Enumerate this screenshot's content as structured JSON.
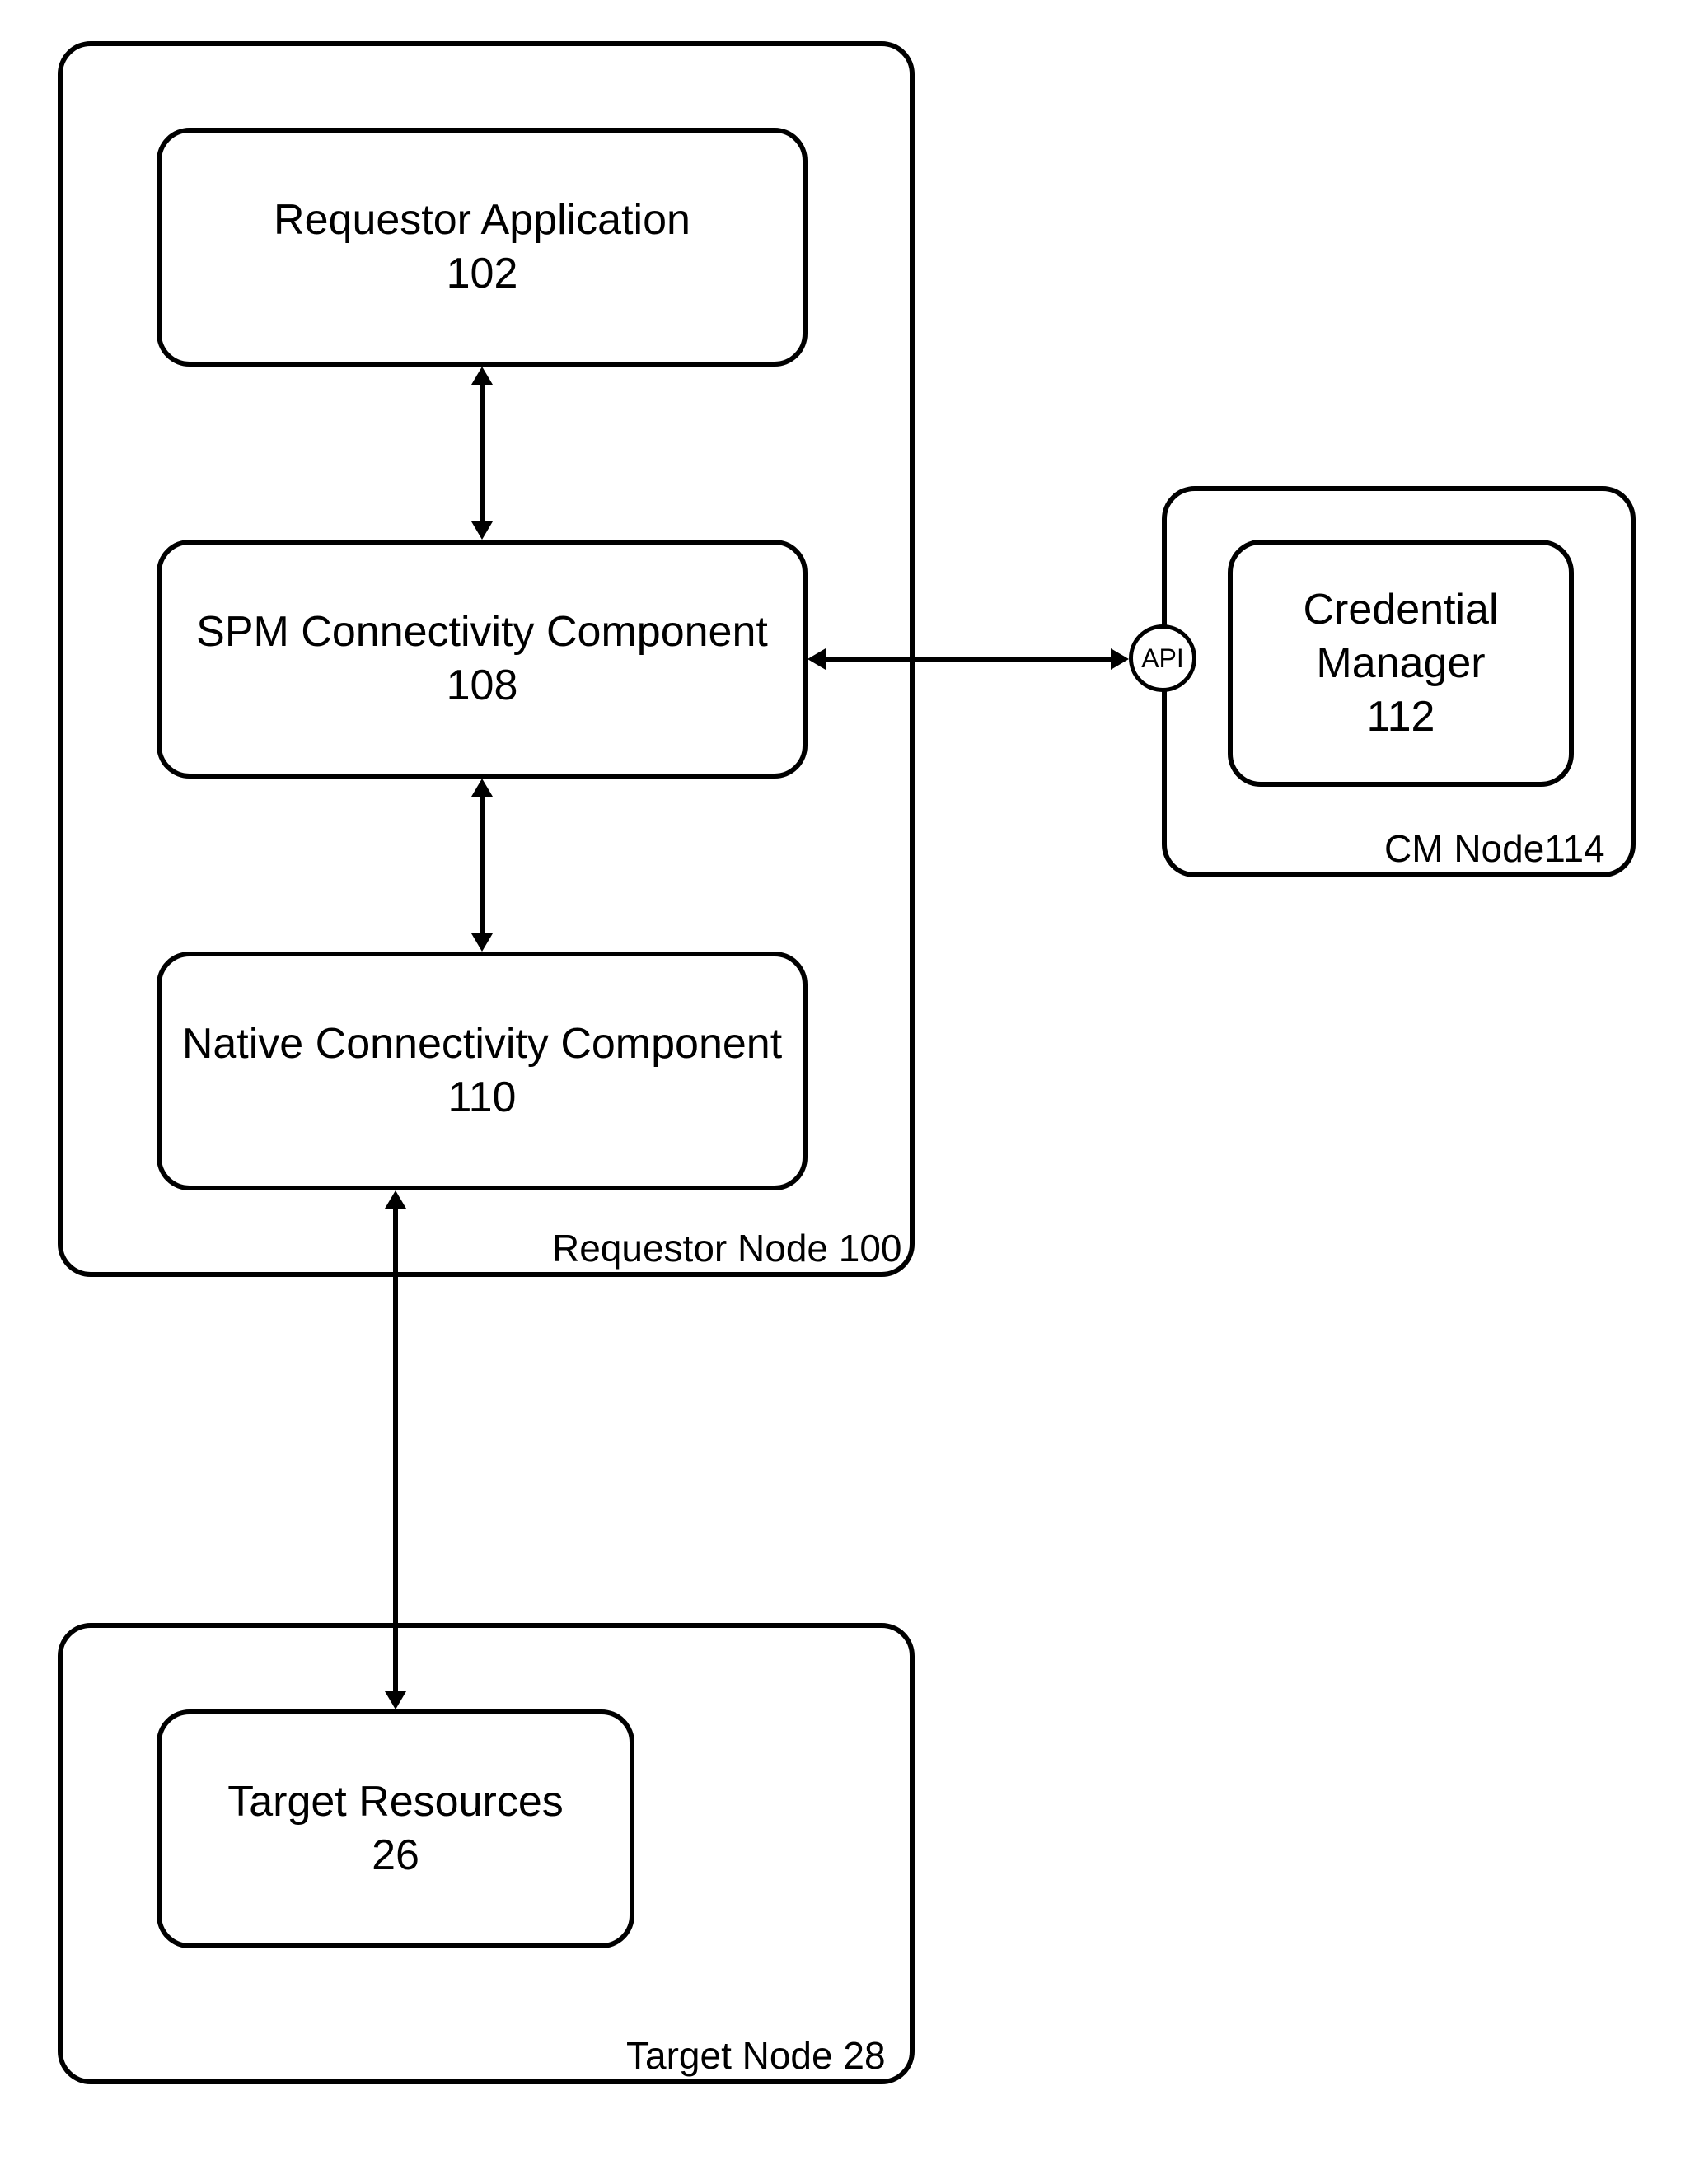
{
  "requestorNode": {
    "label": "Requestor Node 100",
    "requestorApp": {
      "title": "Requestor Application",
      "num": "102"
    },
    "spm": {
      "title": "SPM Connectivity Component",
      "num": "108"
    },
    "native": {
      "title": "Native Connectivity Component",
      "num": "110"
    }
  },
  "cmNode": {
    "label": "CM Node114",
    "credMgr": {
      "title1": "Credential",
      "title2": "Manager",
      "num": "112"
    }
  },
  "targetNode": {
    "label": "Target Node 28",
    "targetRes": {
      "title": "Target Resources",
      "num": "26"
    }
  },
  "api": {
    "label": "API"
  }
}
